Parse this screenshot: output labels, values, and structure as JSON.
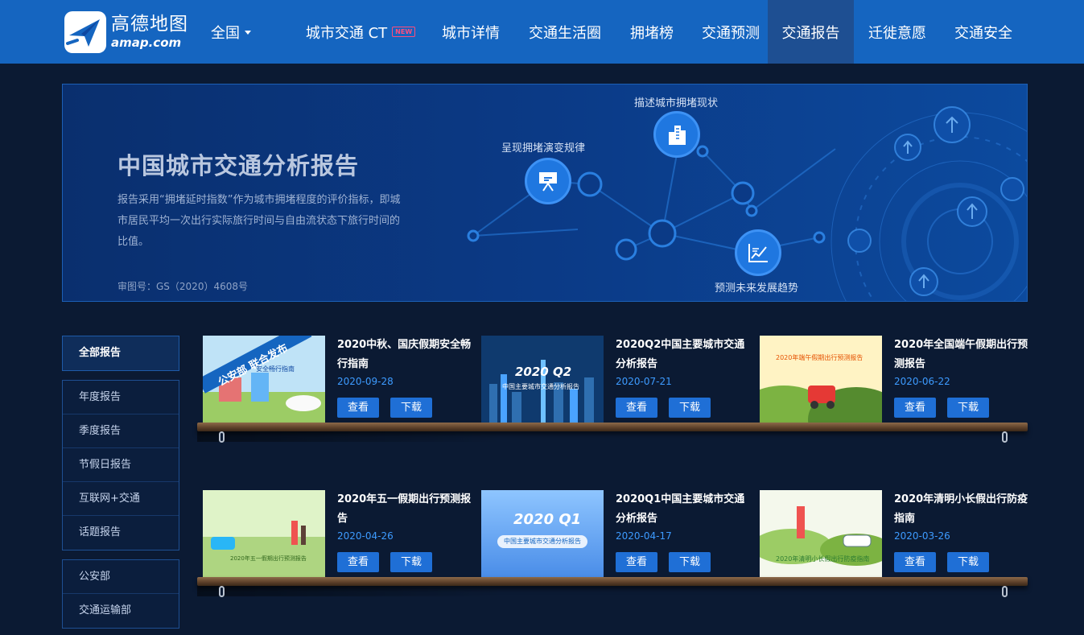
{
  "logo": {
    "cn": "高德地图",
    "en": "amap.com"
  },
  "header": {
    "region": "全国",
    "nav": [
      {
        "label": "城市交通 CT",
        "badge": "NEW"
      },
      {
        "label": "城市详情"
      },
      {
        "label": "交通生活圈"
      },
      {
        "label": "拥堵榜"
      },
      {
        "label": "交通预测"
      },
      {
        "label": "交通报告",
        "active": true
      },
      {
        "label": "迁徙意愿"
      },
      {
        "label": "交通安全"
      }
    ]
  },
  "banner": {
    "title": "中国城市交通分析报告",
    "description": "报告采用“拥堵延时指数”作为城市拥堵程度的评价指标，即城市居民平均一次出行实际旅行时间与自由流状态下旅行时间的比值。",
    "approval_code": "审图号：GS（2020）4608号",
    "features": [
      "呈现拥堵演变规律",
      "描述城市拥堵现状",
      "预测未来发展趋势"
    ]
  },
  "sidebar": {
    "top": "全部报告",
    "categories": [
      "年度报告",
      "季度报告",
      "节假日报告",
      "互联网+交通",
      "话题报告"
    ],
    "departments": [
      "公安部",
      "交通运输部"
    ]
  },
  "reports": [
    {
      "title": "2020中秋、国庆假期安全畅行指南",
      "date": "2020-09-28",
      "thumb_text": "公安部 联合发布",
      "thumb_sub": "安全畅行指南"
    },
    {
      "title": "2020Q2中国主要城市交通分析报告",
      "date": "2020-07-21",
      "thumb_text": "2020 Q2",
      "thumb_sub": "中国主要城市交通分析报告"
    },
    {
      "title": "2020年全国端午假期出行预测报告",
      "date": "2020-06-22",
      "thumb_text": "2020年端午假期出行预测报告",
      "thumb_sub": ""
    },
    {
      "title": "2020年五一假期出行预测报告",
      "date": "2020-04-26",
      "thumb_text": "2020年五一假期出行预测报告",
      "thumb_sub": ""
    },
    {
      "title": "2020Q1中国主要城市交通分析报告",
      "date": "2020-04-17",
      "thumb_text": "2020 Q1",
      "thumb_sub": "中国主要城市交通分析报告"
    },
    {
      "title": "2020年清明小长假出行防疫指南",
      "date": "2020-03-26",
      "thumb_text": "2020年清明小长假出行防疫指南",
      "thumb_sub": ""
    }
  ],
  "buttons": {
    "view": "查看",
    "download": "下载"
  },
  "colors": {
    "header": "#1565c0",
    "page_bg": "#0b1a33",
    "button": "#1f6fd6",
    "date": "#3d9bff"
  }
}
